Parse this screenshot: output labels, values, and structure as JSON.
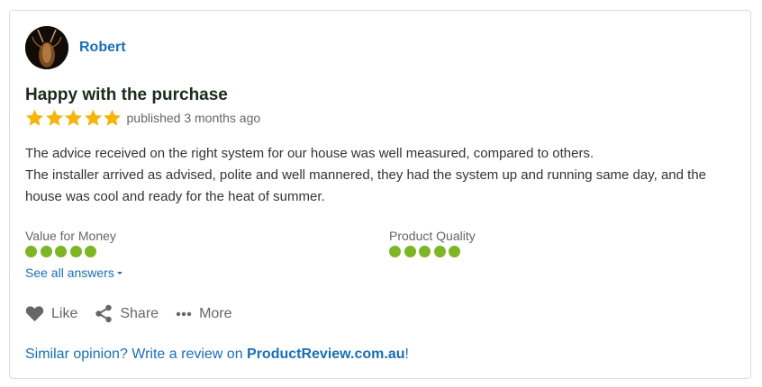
{
  "review": {
    "author": "Robert",
    "avatar_icon": "avatar-insect-portrait",
    "title": "Happy with the purchase",
    "rating_stars": 5,
    "published": "published 3 months ago",
    "body_lines": [
      "The advice received on the right system for our house was well measured, compared to others.",
      "The installer arrived as advised, polite and well mannered, they had the system up and running same day, and the house was cool and ready for the heat of summer."
    ],
    "criteria": [
      {
        "label": "Value for Money",
        "rating": 5
      },
      {
        "label": "Product Quality",
        "rating": 5
      }
    ],
    "see_all": "See all answers",
    "actions": {
      "like": "Like",
      "share": "Share",
      "more": "More"
    },
    "footer": {
      "prefix": "Similar opinion? Write a review on ",
      "link": "ProductReview.com.au",
      "suffix": "!"
    }
  },
  "colors": {
    "star": "#f5b50a",
    "dot": "#7db524",
    "link": "#1a6fb5"
  }
}
